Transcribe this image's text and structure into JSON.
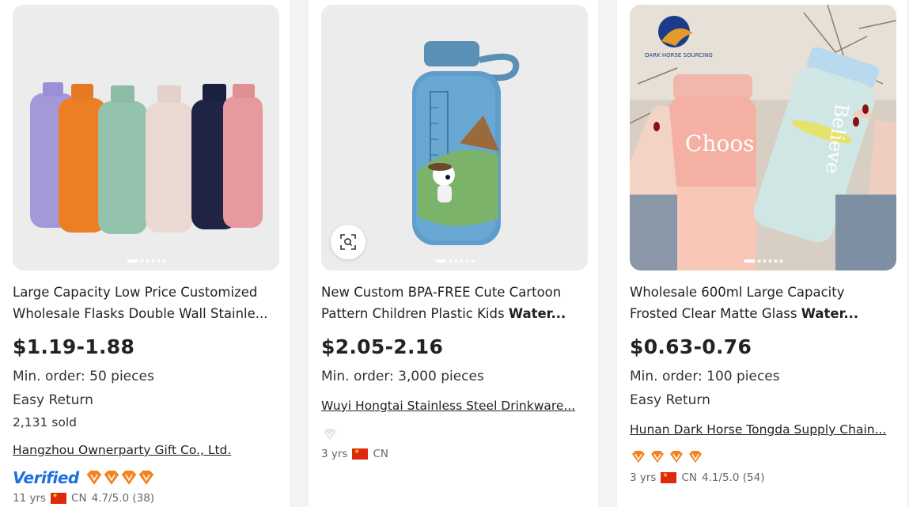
{
  "products": [
    {
      "title_plain": "Large Capacity Low Price Customized Wholesale Flasks Double Wall Stainle...",
      "title_bold": "",
      "price": "$1.19-1.88",
      "min_order": "Min. order: 50 pieces",
      "easy_return": "Easy Return",
      "sold": "2,131 sold",
      "supplier": "Hangzhou Ownerparty Gift Co., Ltd.",
      "verified": "Verified",
      "years": "11 yrs",
      "country": "CN",
      "rating": "4.7/5.0 (38)",
      "image_dots": 6
    },
    {
      "title_plain": "New Custom BPA-FREE Cute Cartoon Pattern Children Plastic Kids ",
      "title_bold": "Water...",
      "price": "$2.05-2.16",
      "min_order": "Min. order: 3,000 pieces",
      "supplier": "Wuyi Hongtai Stainless Steel Drinkware...",
      "years": "3 yrs",
      "country": "CN",
      "image_dots": 6
    },
    {
      "title_plain": "Wholesale 600ml Large Capacity Frosted Clear Matte Glass ",
      "title_bold": "Water...",
      "price": "$0.63-0.76",
      "min_order": "Min. order: 100 pieces",
      "easy_return": "Easy Return",
      "supplier": "Hunan Dark Horse Tongda Supply Chain...",
      "years": "3 yrs",
      "country": "CN",
      "rating": "4.1/5.0 (54)",
      "image_dots": 6,
      "image_brand": "DARK HORSE SOURCING",
      "image_text_1": "Choos",
      "image_text_2": "Believe"
    }
  ],
  "colors": {
    "diamond_orange": "#f5811f",
    "verified_blue": "#1d6fe0",
    "diamond_gray": "#e6e6e6"
  }
}
